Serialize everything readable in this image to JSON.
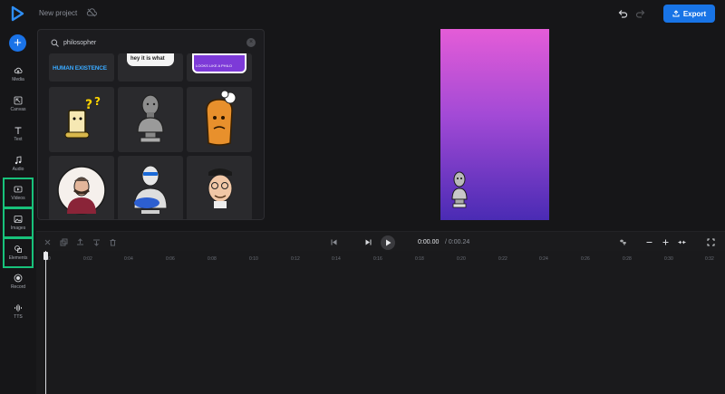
{
  "header": {
    "project_title": "New project",
    "export_label": "Export"
  },
  "sidebar": {
    "items": [
      {
        "label": "Media",
        "icon": "upload-cloud-icon"
      },
      {
        "label": "Canvas",
        "icon": "canvas-resize-icon"
      },
      {
        "label": "Text",
        "icon": "text-icon"
      },
      {
        "label": "Audio",
        "icon": "music-note-icon"
      },
      {
        "label": "Videos",
        "icon": "video-icon"
      },
      {
        "label": "Images",
        "icon": "image-icon"
      },
      {
        "label": "Elements",
        "icon": "shapes-icon"
      },
      {
        "label": "Record",
        "icon": "record-icon"
      },
      {
        "label": "TTS",
        "icon": "sound-wave-icon"
      }
    ]
  },
  "elements_panel": {
    "search_value": "philosopher",
    "top_row_texts": [
      "HUMAN EXISTENCE",
      "hey it is what",
      "LOOKS LIKE A PHILO"
    ]
  },
  "timeline": {
    "current_time": "0:00.00",
    "total_time": "/ 0:00.24",
    "ticks": [
      "0",
      "0:02",
      "0:04",
      "0:06",
      "0:08",
      "0:10",
      "0:12",
      "0:14",
      "0:16",
      "0:18",
      "0:20",
      "0:22",
      "0:24",
      "0:26",
      "0:28",
      "0:30",
      "0:32"
    ]
  },
  "colors": {
    "accent": "#1874e6",
    "highlight": "#18c27b",
    "canvas_top": "#e45cd7",
    "canvas_bottom": "#4a2bb4"
  }
}
